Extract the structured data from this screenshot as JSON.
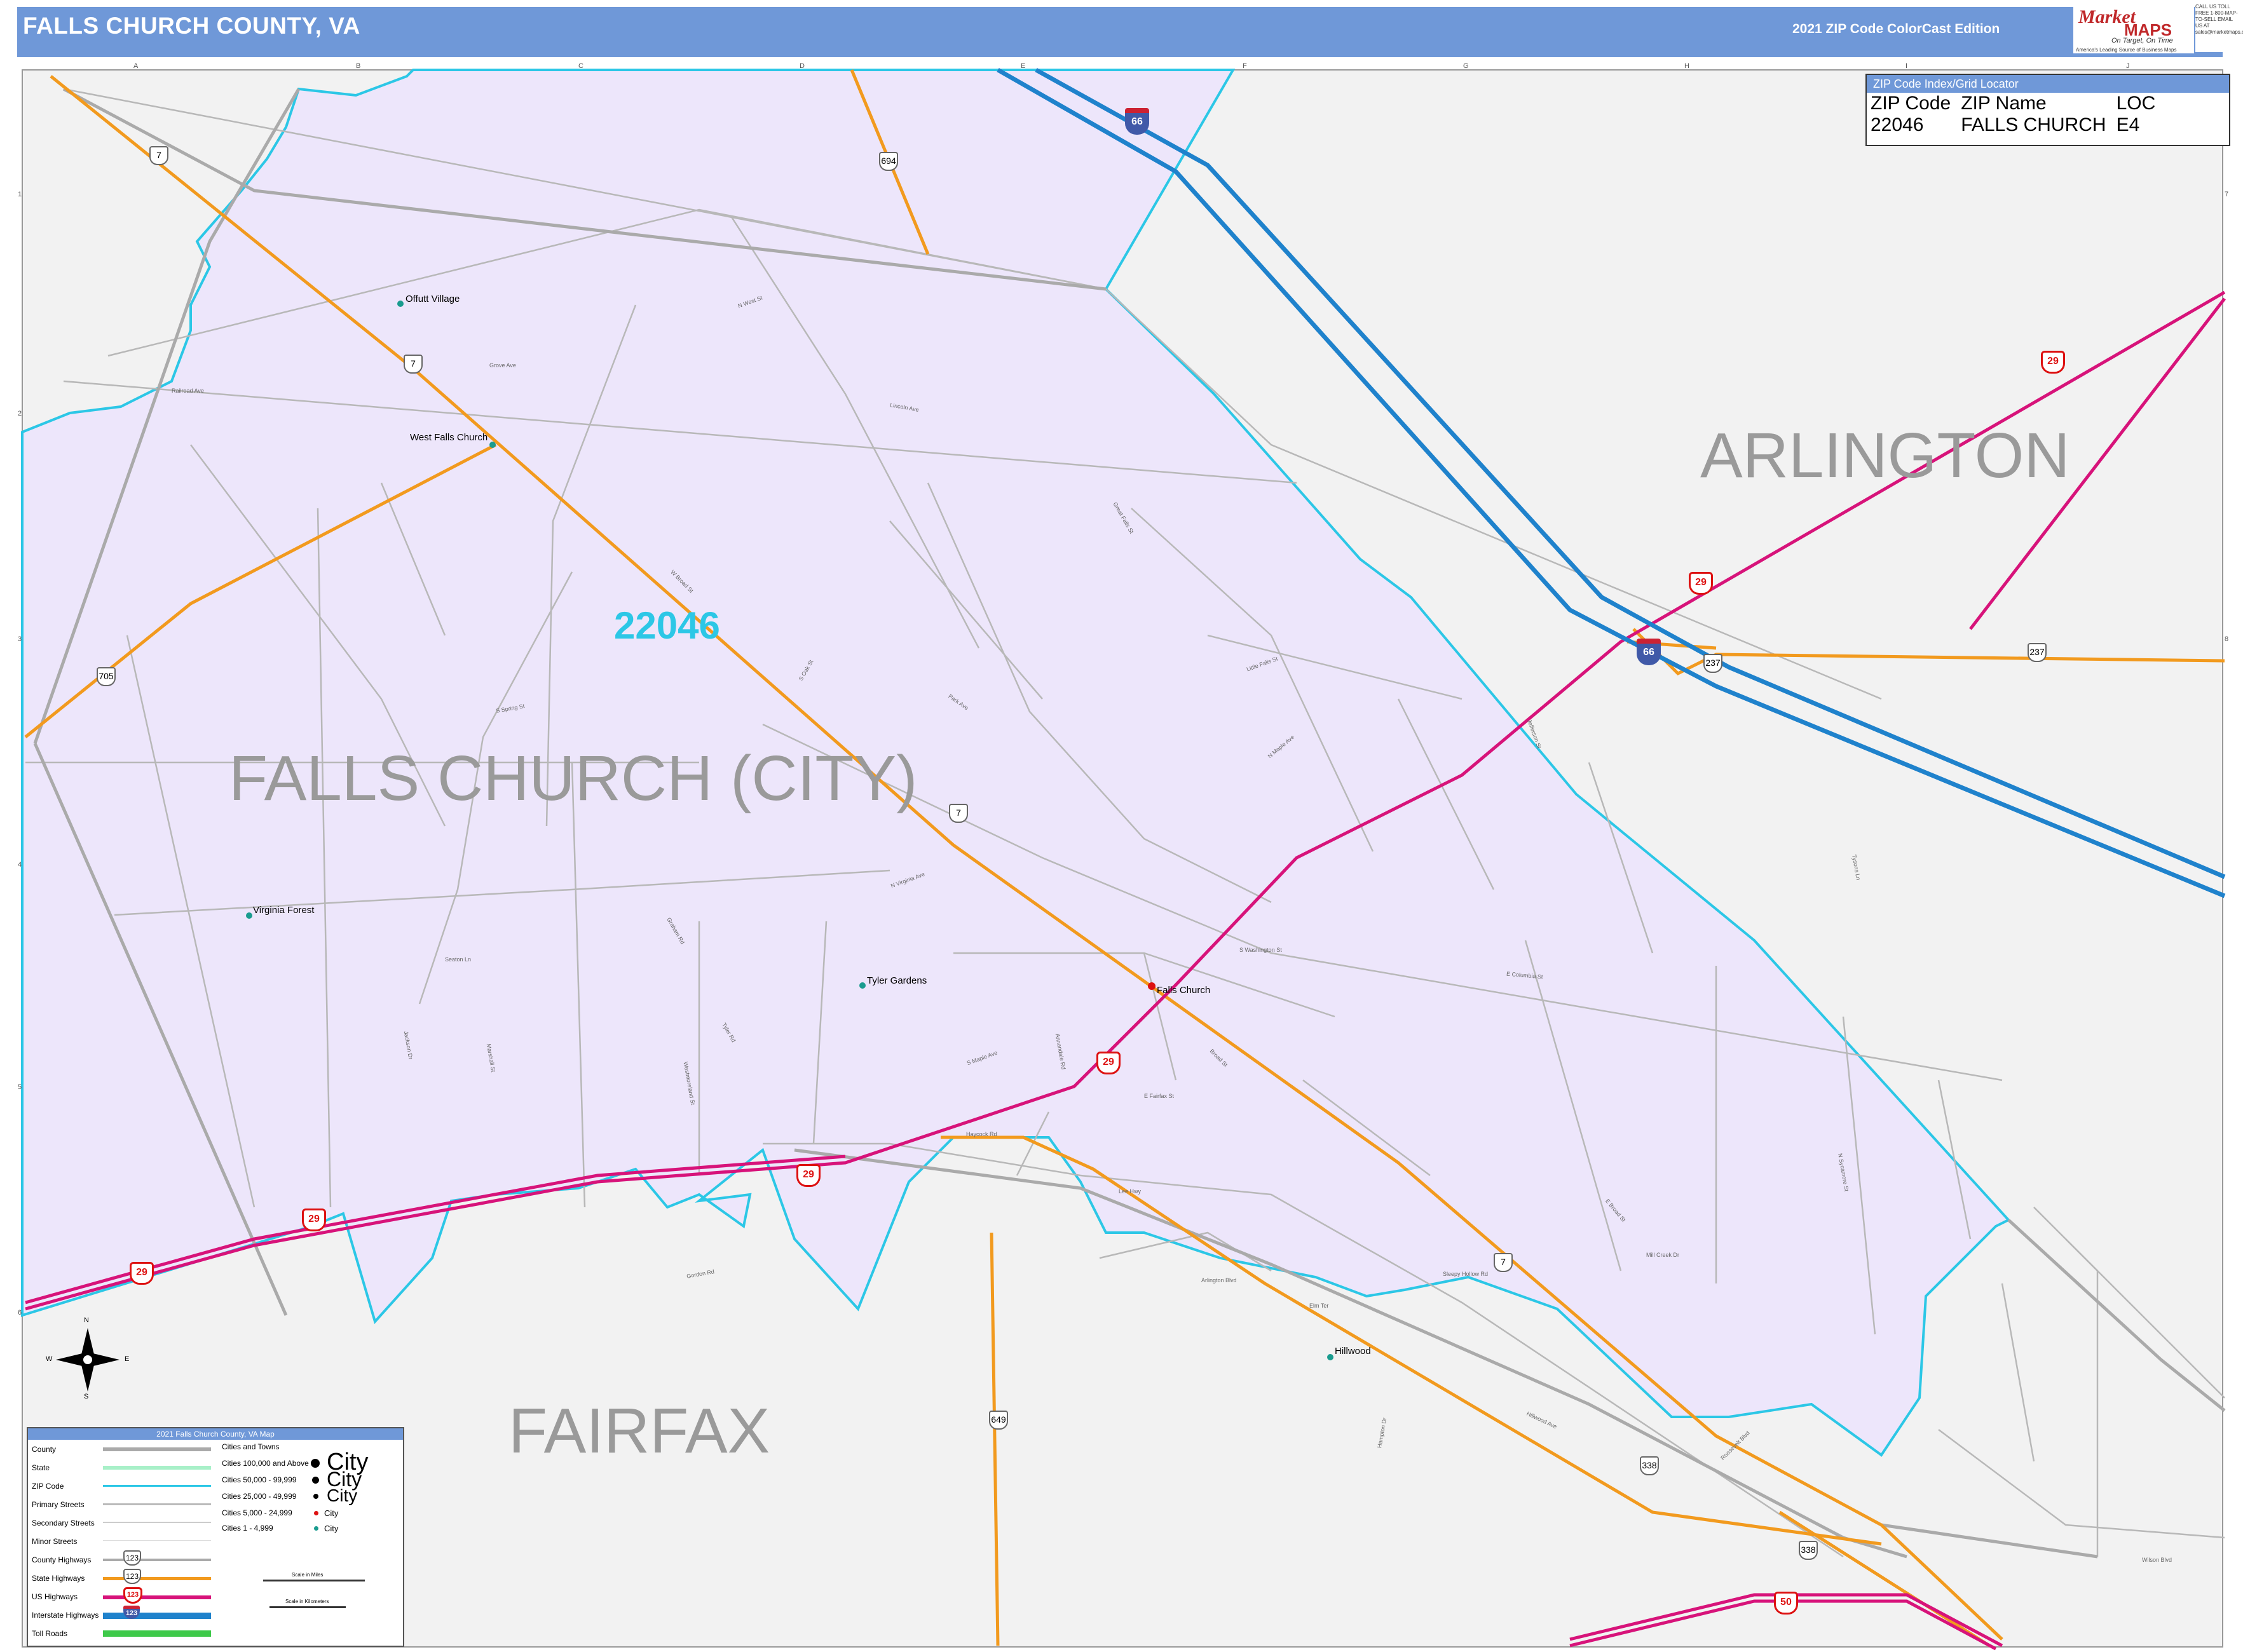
{
  "header": {
    "title": "FALLS CHURCH COUNTY, VA",
    "edition": "2021 ZIP Code ColorCast Edition",
    "logo_market": "Market",
    "logo_maps": "MAPS",
    "logo_tagline": "On Target, On Time",
    "logo_sub": "America's Leading Source of Business Maps",
    "contact": "CALL US TOLL FREE 1-800-MAP-TO-SELL EMAIL US AT sales@marketmaps.com"
  },
  "grid": {
    "columns": [
      "A",
      "B",
      "C",
      "D",
      "E",
      "F",
      "G",
      "H",
      "I",
      "J"
    ],
    "rows": [
      "1",
      "2",
      "3",
      "4",
      "5",
      "6",
      "7",
      "8"
    ]
  },
  "regions": {
    "arlington": "ARLINGTON",
    "fairfax": "FAIRFAX",
    "falls_church_city": "FALLS CHURCH (CITY)",
    "zip": "22046"
  },
  "places": [
    {
      "name": "Offutt Village"
    },
    {
      "name": "West Falls Church"
    },
    {
      "name": "Virginia Forest"
    },
    {
      "name": "Tyler Gardens"
    },
    {
      "name": "Falls Church"
    },
    {
      "name": "Hillwood"
    }
  ],
  "routes": {
    "state": [
      "7",
      "7",
      "7",
      "7",
      "694",
      "705",
      "649",
      "237",
      "237",
      "338",
      "338"
    ],
    "us": [
      "29",
      "29",
      "29",
      "29",
      "29",
      "29",
      "50"
    ],
    "interstate": [
      "66",
      "66"
    ]
  },
  "streets": [
    "Lincoln Ave",
    "N West St",
    "Park Ave",
    "Broad St",
    "E Columbia St",
    "E Fairfax St",
    "Little Falls St",
    "S Washington St",
    "W Broad St",
    "Hillwood Ave",
    "Annandale Rd",
    "N Maple Ave",
    "S Oak St",
    "Great Falls St",
    "Haycock Rd",
    "Railroad Ave",
    "Gordon Rd",
    "N Sycamore St",
    "Jefferson St",
    "Roosevelt Blvd",
    "Wilson Blvd",
    "Tysons Ln",
    "Grove Ave",
    "Seaton Ln",
    "E Broad St",
    "N Virginia Ave",
    "Westmoreland St",
    "Tyler Rd",
    "S Maple Ave",
    "Jackson Dr",
    "S Spring St",
    "Marshall St",
    "Graham Rd",
    "Mill Creek Dr",
    "Hampton Dr",
    "Lee Hwy",
    "Elm Ter",
    "Arlington Blvd",
    "Sleepy Hollow Rd"
  ],
  "zip_index": {
    "header": "ZIP Code Index/Grid Locator",
    "columns": [
      "ZIP Code",
      "ZIP Name",
      "LOC"
    ],
    "rows": [
      [
        "22046",
        "FALLS CHURCH",
        "E4"
      ]
    ]
  },
  "legend": {
    "title": "2021 Falls Church County, VA Map",
    "items": [
      "County",
      "State",
      "ZIP Code",
      "Primary Streets",
      "Secondary Streets",
      "Minor Streets",
      "County Highways",
      "State Highways",
      "US Highways",
      "Interstate Highways",
      "Toll Roads"
    ],
    "shield_sample": "123",
    "cities_title": "Cities and Towns",
    "cities": [
      {
        "label": "Cities 100,000 and Above",
        "sample": "City"
      },
      {
        "label": "Cities 50,000 - 99,999",
        "sample": "City"
      },
      {
        "label": "Cities 25,000 - 49,999",
        "sample": "City"
      },
      {
        "label": "Cities 5,000 - 24,999",
        "sample": "City"
      },
      {
        "label": "Cities 1 - 4,999",
        "sample": "City"
      }
    ],
    "scale_miles": "Scale in Miles",
    "scale_km": "Scale in Kilometers",
    "compass": [
      "N",
      "S",
      "E",
      "W"
    ]
  },
  "colors": {
    "header": "#6f98d8",
    "zip_fill": "#ede6fb",
    "outside_fill": "#f2f2f2",
    "zip_boundary": "#2cc7e6",
    "state_hwy": "#f29a1e",
    "us_hwy": "#d7137a",
    "interstate": "#1f82cc",
    "street": "#b8b8b8"
  }
}
